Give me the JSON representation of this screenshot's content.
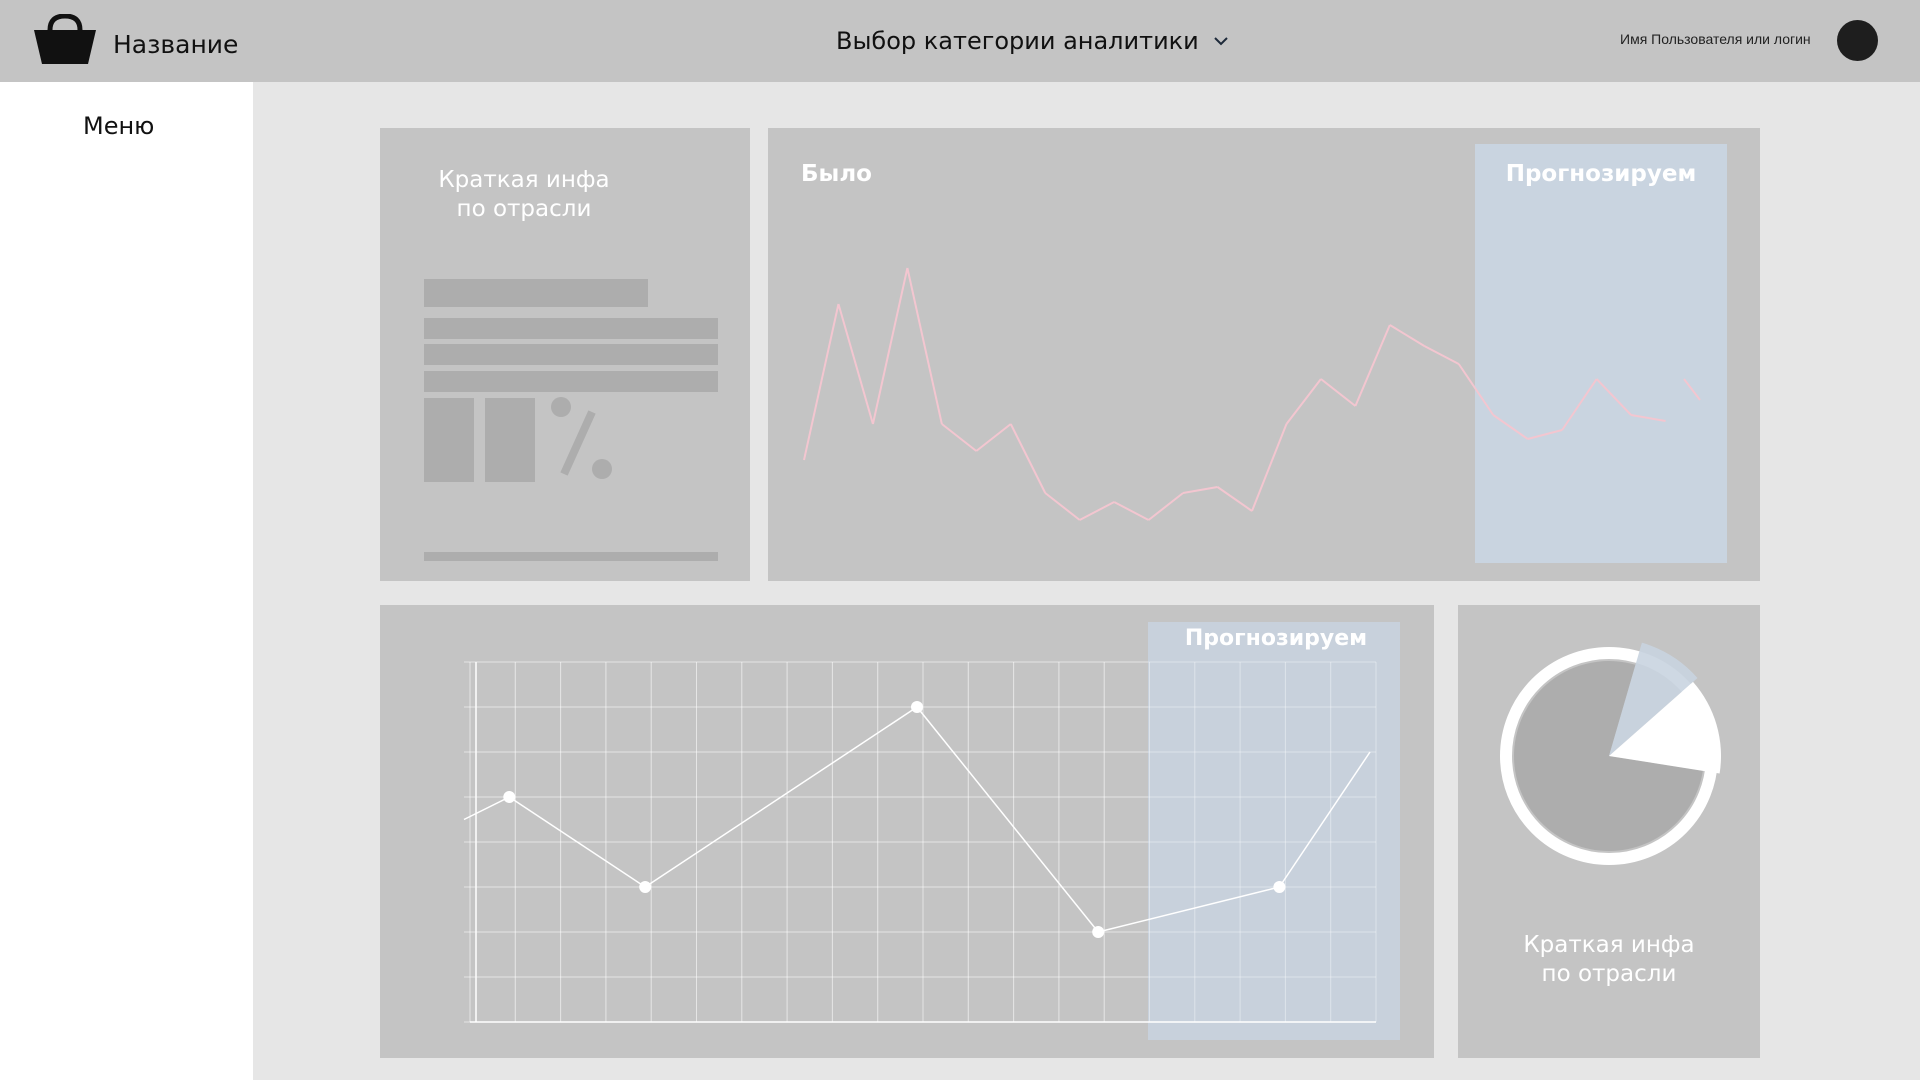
{
  "header": {
    "app_title": "Название",
    "category_select": "Выбор категории аналитики",
    "user_name": "Имя Пользователя или логин",
    "icons": {
      "logo": "basket-icon",
      "dropdown": "chevron-down-icon",
      "avatar": "avatar-circle"
    }
  },
  "sidebar": {
    "menu_label": "Меню"
  },
  "cards": {
    "info_top": {
      "title_line1": "Краткая инфа",
      "title_line2": "по отрасли",
      "icon": "percent-icon"
    },
    "history": {
      "label_past": "Было",
      "label_forecast": "Прогнозируем"
    },
    "forecast": {
      "label_forecast": "Прогнозируем"
    },
    "pie": {
      "title_line1": "Краткая инфа",
      "title_line2": "по отрасли"
    }
  },
  "colors": {
    "topbar": "#c4c4c4",
    "sidebar": "#ffffff",
    "canvas": "#e6e6e6",
    "card": "#c4c4c4",
    "forecast_band": "#c9d4e0",
    "history_line": "#f3c6d0",
    "forecast_line": "#ffffff",
    "skeleton": "#adadad"
  },
  "chart_data": [
    {
      "type": "line",
      "name": "history",
      "x": [
        0,
        1,
        2,
        3,
        4,
        5,
        6,
        7,
        8,
        9,
        10,
        11,
        12,
        13,
        14,
        15,
        16,
        17,
        18,
        19,
        20,
        21,
        22,
        23,
        24,
        25,
        26
      ],
      "values": [
        20,
        72,
        32,
        84,
        32,
        23,
        32,
        9,
        0,
        6,
        0,
        9,
        11,
        3,
        32,
        47,
        38,
        65,
        58,
        52,
        35,
        27,
        30,
        47,
        35,
        33,
        40
      ],
      "forecast_from_index": 17,
      "ylim": [
        0,
        100
      ],
      "grid": false
    },
    {
      "type": "line",
      "name": "forecast",
      "x": [
        0,
        1,
        4,
        10,
        14,
        18,
        20
      ],
      "values": [
        45,
        50,
        30,
        70,
        20,
        30,
        60
      ],
      "markers_at": [
        1,
        4,
        10,
        14,
        18
      ],
      "forecast_from": 15,
      "xlim": [
        0,
        20
      ],
      "ylim": [
        0,
        80
      ],
      "grid": true
    },
    {
      "type": "pie",
      "name": "share",
      "values": [
        77,
        9,
        14
      ],
      "colors": [
        "#adadad",
        "#c9d4e0",
        "#ffffff"
      ]
    }
  ]
}
